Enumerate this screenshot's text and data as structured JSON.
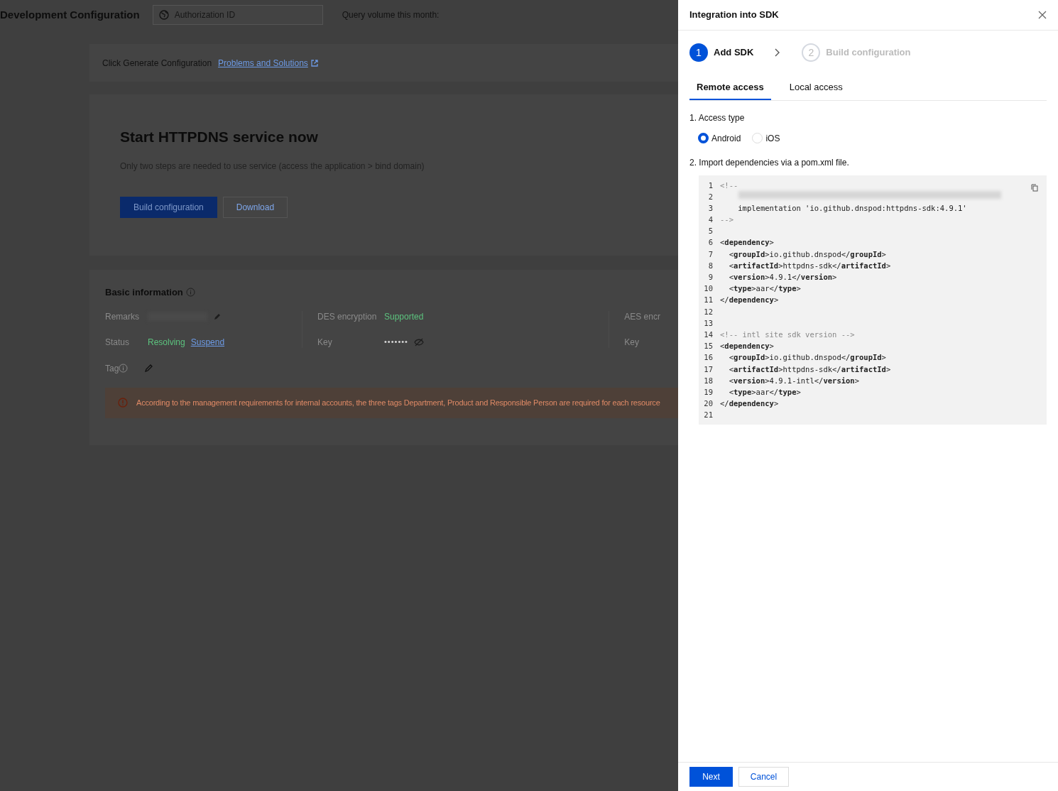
{
  "page": {
    "title": "Development Configuration",
    "auth_field": {
      "placeholder": "Authorization ID"
    },
    "query_label": "Query volume this month:",
    "notice": {
      "text": "Click Generate Configuration",
      "link": "Problems and Solutions"
    },
    "hero": {
      "title": "Start HTTPDNS service now",
      "description": "Only two steps are needed to use service (access the application > bind domain)",
      "buttons": [
        {
          "label": "Build configuration",
          "kind": "primary"
        },
        {
          "label": "Download",
          "kind": "secondary"
        }
      ]
    },
    "basic_info": {
      "title": "Basic information",
      "columns": [
        [
          {
            "label": "Remarks",
            "kind": "redacted"
          },
          {
            "label": "Status",
            "kind": "status",
            "value": "Resolving",
            "action": "Suspend"
          }
        ],
        [
          {
            "label": "DES encryption",
            "kind": "status",
            "value": "Supported"
          },
          {
            "label": "Key",
            "kind": "secret",
            "value": "•••••••"
          }
        ],
        [
          {
            "label": "AES encr",
            "kind": "empty"
          },
          {
            "label": "Key",
            "kind": "empty"
          }
        ]
      ],
      "tag_label": "Tag",
      "warning": "According to the management requirements for internal accounts, the three tags Department, Product and Responsible Person are required for each resource"
    }
  },
  "drawer": {
    "title": "Integration into SDK",
    "steps": [
      {
        "number": "1",
        "label": "Add SDK",
        "selected": true
      },
      {
        "number": "2",
        "label": "Build configuration",
        "selected": false
      }
    ],
    "tabs": [
      {
        "label": "Remote access",
        "selected": true
      },
      {
        "label": "Local access",
        "selected": false
      }
    ],
    "access_label": "1. Access type",
    "radios": [
      {
        "label": "Android",
        "selected": true
      },
      {
        "label": "iOS",
        "selected": false
      }
    ],
    "import_label": "2. Import dependencies via a pom.xml file.",
    "code_lines": [
      {
        "number": "1",
        "kind": "comment",
        "text": "<!--"
      },
      {
        "number": "2",
        "kind": "redacted"
      },
      {
        "number": "3",
        "kind": "plain",
        "text": "    implementation 'io.github.dnspod:httpdns-sdk:4.9.1'"
      },
      {
        "number": "4",
        "kind": "comment",
        "text": "-->"
      },
      {
        "number": "5",
        "kind": "empty"
      },
      {
        "number": "6",
        "kind": "plain",
        "text": "<**dependency**>"
      },
      {
        "number": "7",
        "kind": "plain",
        "text": "  <**groupId**>io.github.dnspod</**groupId**>"
      },
      {
        "number": "8",
        "kind": "plain",
        "text": "  <**artifactId**>httpdns-sdk</**artifactId**>"
      },
      {
        "number": "9",
        "kind": "plain",
        "text": "  <**version**>4.9.1</**version**>"
      },
      {
        "number": "10",
        "kind": "plain",
        "text": "  <**type**>aar</**type**>"
      },
      {
        "number": "11",
        "kind": "plain",
        "text": "</**dependency**>"
      },
      {
        "number": "12",
        "kind": "empty"
      },
      {
        "number": "13",
        "kind": "empty"
      },
      {
        "number": "14",
        "kind": "comment",
        "text": "<!-- intl site sdk version -->"
      },
      {
        "number": "15",
        "kind": "plain",
        "text": "<**dependency**>"
      },
      {
        "number": "16",
        "kind": "plain",
        "text": "  <**groupId**>io.github.dnspod</**groupId**>"
      },
      {
        "number": "17",
        "kind": "plain",
        "text": "  <**artifactId**>httpdns-sdk</**artifactId**>"
      },
      {
        "number": "18",
        "kind": "plain",
        "text": "  <**version**>4.9.1-intl</**version**>"
      },
      {
        "number": "19",
        "kind": "plain",
        "text": "  <**type**>aar</**type**>"
      },
      {
        "number": "20",
        "kind": "plain",
        "text": "</**dependency**>"
      },
      {
        "number": "21",
        "kind": "empty"
      }
    ],
    "buttons": [
      {
        "label": "Next",
        "kind": "primary"
      },
      {
        "label": "Cancel",
        "kind": "secondary"
      }
    ]
  }
}
